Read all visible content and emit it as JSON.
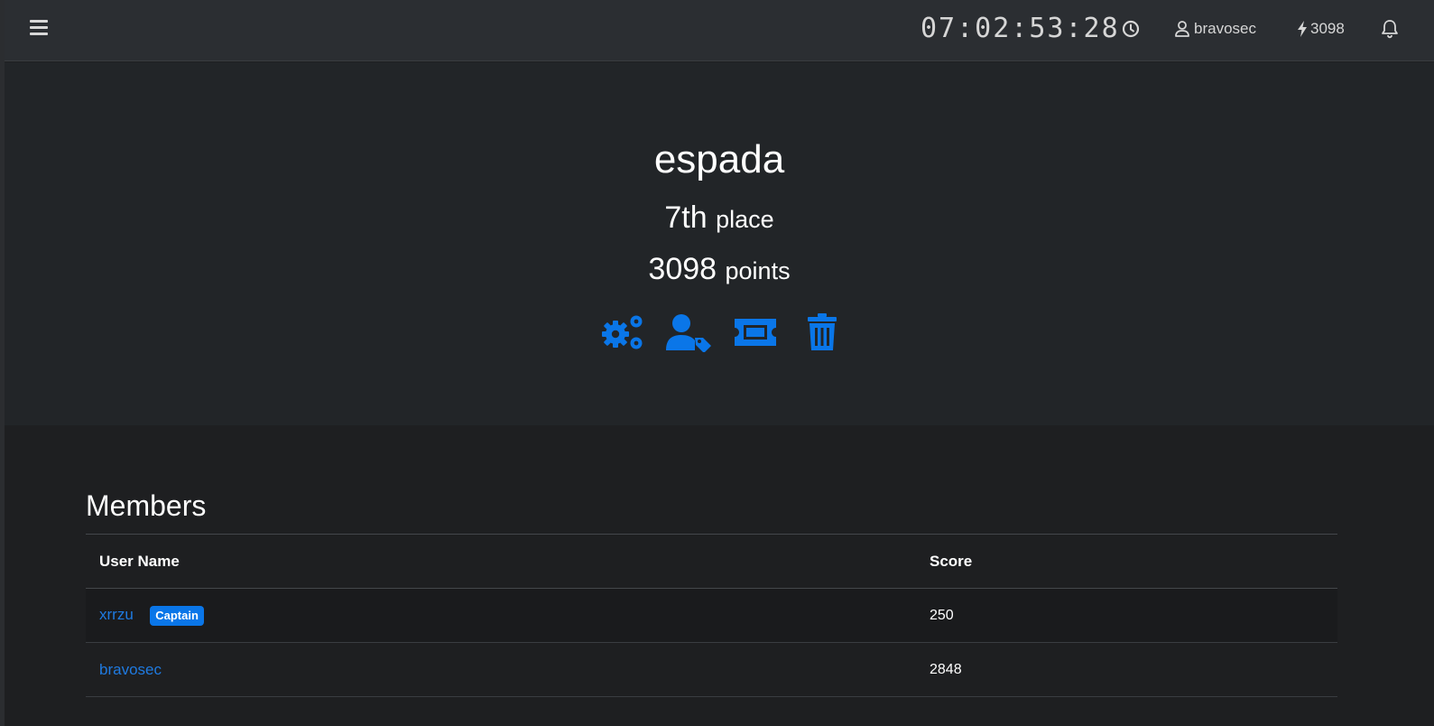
{
  "topbar": {
    "timer": "07:02:53:28",
    "username": "bravosec",
    "points": "3098"
  },
  "team": {
    "name": "espada",
    "place_value": "7th",
    "place_label": "place",
    "points_value": "3098",
    "points_label": "points"
  },
  "actions": [
    {
      "icon": "gears-icon"
    },
    {
      "icon": "user-tag-icon"
    },
    {
      "icon": "ticket-icon"
    },
    {
      "icon": "trash-icon"
    }
  ],
  "members": {
    "title": "Members",
    "columns": [
      "User Name",
      "Score"
    ],
    "rows": [
      {
        "name": "xrrzu",
        "badge": "Captain",
        "score": "250"
      },
      {
        "name": "bravosec",
        "badge": "",
        "score": "2848"
      }
    ]
  },
  "colors": {
    "accent": "#0a76e8",
    "link": "#1f7ae0",
    "topbar_bg": "#2b2e32",
    "hero_bg": "#222528",
    "page_bg": "#1e1f21"
  }
}
